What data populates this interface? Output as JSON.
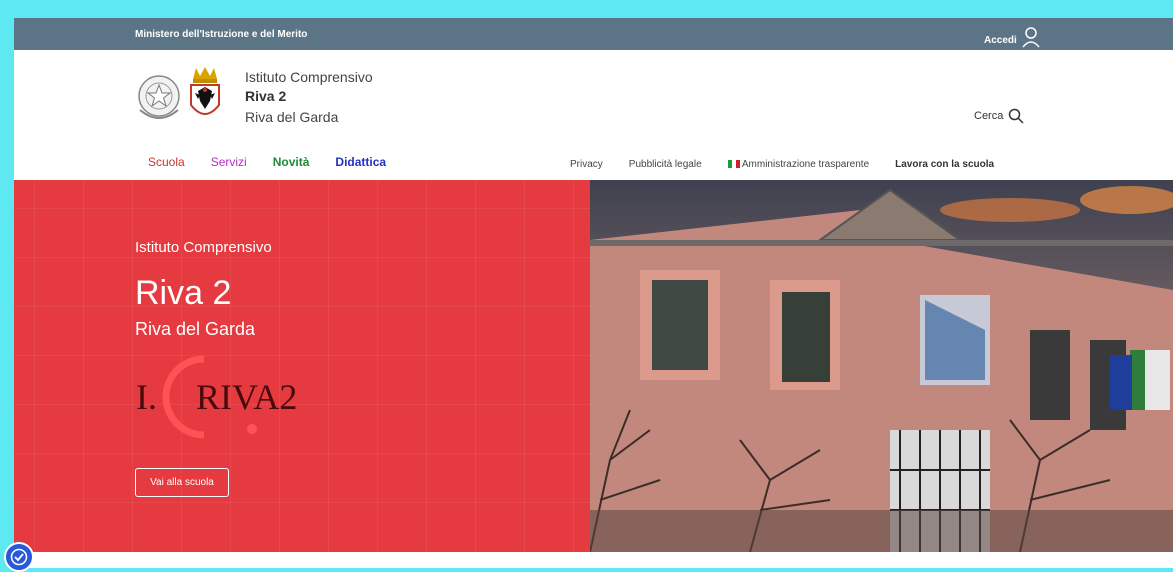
{
  "topbar": {
    "ministry": "Ministero dell'Istruzione e del Merito",
    "login_label": "Accedi"
  },
  "header": {
    "institute_line1": "Istituto Comprensivo",
    "institute_line2": "Riva 2",
    "institute_line3": "Riva del Garda",
    "search_label": "Cerca"
  },
  "nav_main": [
    {
      "label": "Scuola",
      "color": "#c0392b"
    },
    {
      "label": "Servizi",
      "color": "#b02fbf"
    },
    {
      "label": "Novità",
      "color": "#1f8a3a"
    },
    {
      "label": "Didattica",
      "color": "#2230c0"
    }
  ],
  "nav_secondary": {
    "privacy": "Privacy",
    "legal": "Pubblicità legale",
    "transparency": "Amministrazione trasparente",
    "work": "Lavora con la scuola"
  },
  "hero": {
    "subtitle": "Istituto Comprensivo",
    "title": "Riva 2",
    "city": "Riva del Garda",
    "logo_text_left": "I.",
    "logo_text_right": "RIVA2",
    "cta_label": "Vai alla scuola",
    "accent_color": "#e53a3f"
  },
  "icons": {
    "user": "user-icon",
    "search": "search-icon",
    "accessibility": "accessibility-icon"
  }
}
